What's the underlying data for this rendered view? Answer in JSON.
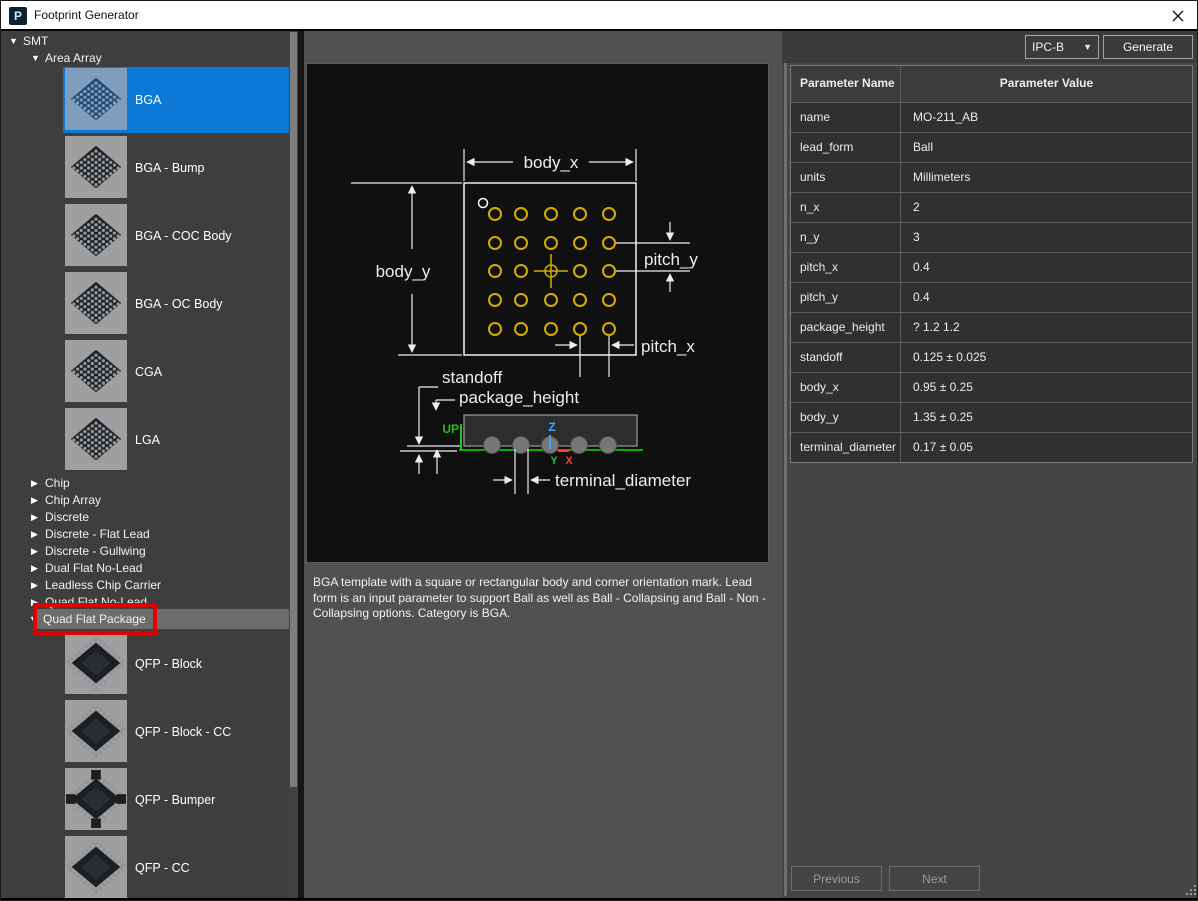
{
  "window": {
    "title": "Footprint Generator"
  },
  "toolbar": {
    "standard_value": "IPC-B",
    "generate_label": "Generate"
  },
  "sidebar": {
    "root": "SMT",
    "group": "Area Array",
    "items": [
      {
        "label": "BGA",
        "selected": true
      },
      {
        "label": "BGA - Bump",
        "selected": false
      },
      {
        "label": "BGA - COC Body",
        "selected": false
      },
      {
        "label": "BGA - OC Body",
        "selected": false
      },
      {
        "label": "CGA",
        "selected": false
      },
      {
        "label": "LGA",
        "selected": false
      }
    ],
    "categories": [
      "Chip",
      "Chip Array",
      "Discrete",
      "Discrete - Flat Lead",
      "Discrete - Gullwing",
      "Dual Flat No-Lead",
      "Leadless Chip Carrier",
      "Quad Flat No-Lead"
    ],
    "expanded_category": "Quad Flat Package",
    "qfp_items": [
      {
        "label": "QFP - Block"
      },
      {
        "label": "QFP - Block - CC"
      },
      {
        "label": "QFP - Bumper"
      },
      {
        "label": "QFP - CC"
      }
    ]
  },
  "diagram": {
    "labels": {
      "body_x": "body_x",
      "body_y": "body_y",
      "pitch_y": "pitch_y",
      "pitch_x": "pitch_x",
      "standoff": "standoff",
      "package_height": "package_height",
      "terminal_diameter": "terminal_diameter",
      "up": "UP",
      "z": "Z",
      "y": "Y",
      "x": "X"
    }
  },
  "description": "BGA template with a square or rectangular body and corner orientation mark. Lead form is an input parameter to support Ball as well as Ball - Collapsing and Ball - Non - Collapsing options. Category is BGA.",
  "parameters": {
    "headers": [
      "Parameter Name",
      "Parameter Value"
    ],
    "rows": [
      [
        "name",
        "MO-211_AB"
      ],
      [
        "lead_form",
        "Ball"
      ],
      [
        "units",
        "Millimeters"
      ],
      [
        "n_x",
        "2"
      ],
      [
        "n_y",
        "3"
      ],
      [
        "pitch_x",
        "0.4"
      ],
      [
        "pitch_y",
        "0.4"
      ],
      [
        "package_height",
        "? 1.2 1.2"
      ],
      [
        "standoff",
        "0.125 ± 0.025"
      ],
      [
        "body_x",
        "0.95 ± 0.25"
      ],
      [
        "body_y",
        "1.35 ± 0.25"
      ],
      [
        "terminal_diameter",
        "0.17 ± 0.05"
      ]
    ]
  },
  "footer": {
    "previous_label": "Previous",
    "next_label": "Next"
  },
  "colors": {
    "selection_blue": "#0b79d5",
    "annotation_red": "#e10000",
    "pad_yellow": "#d4ad00",
    "board_green": "#00b400",
    "axis_z_blue": "#42a5ff",
    "axis_x_red": "#ff4020",
    "axis_y_green": "#24c024"
  }
}
